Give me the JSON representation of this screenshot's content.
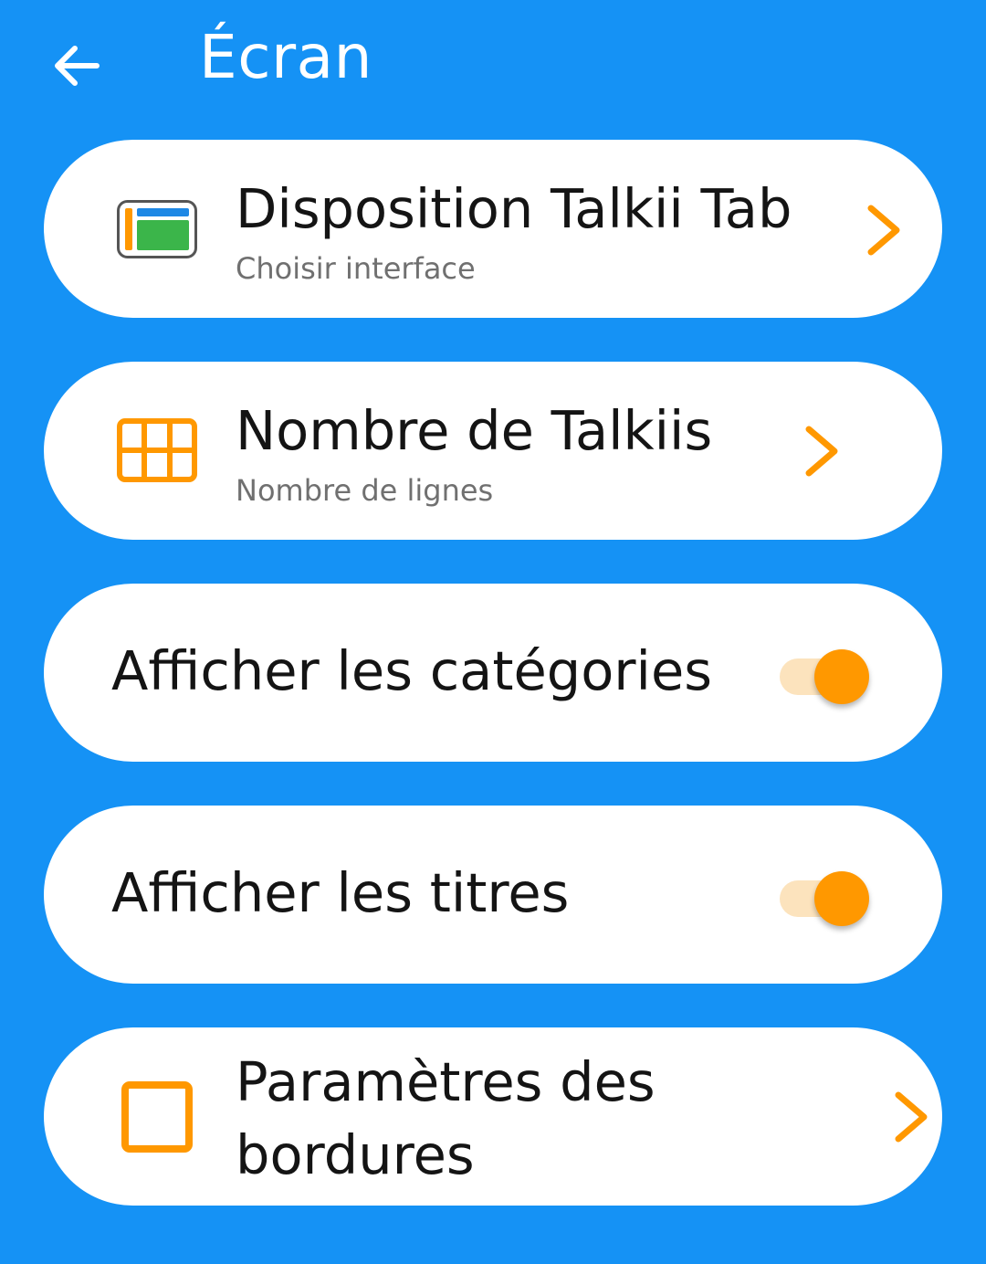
{
  "header": {
    "title": "Écran",
    "back_icon": "arrow-left-icon"
  },
  "colors": {
    "background": "#1592F5",
    "accent": "#FF9800",
    "card": "#FFFFFF"
  },
  "items": [
    {
      "title": "Disposition Talkii Tab",
      "subtitle": "Choisir interface",
      "icon": "layout-icon",
      "trailing": "chevron-right-icon"
    },
    {
      "title": "Nombre de Talkiis",
      "subtitle": "Nombre de lignes",
      "icon": "grid-icon",
      "trailing": "chevron-right-icon"
    },
    {
      "title": "Afficher les catégories",
      "toggle_on": true
    },
    {
      "title": "Afficher les titres",
      "toggle_on": true
    },
    {
      "title_line1": "Paramètres des",
      "title_line2": "bordures",
      "icon": "square-outline-icon",
      "trailing": "chevron-right-icon"
    }
  ]
}
